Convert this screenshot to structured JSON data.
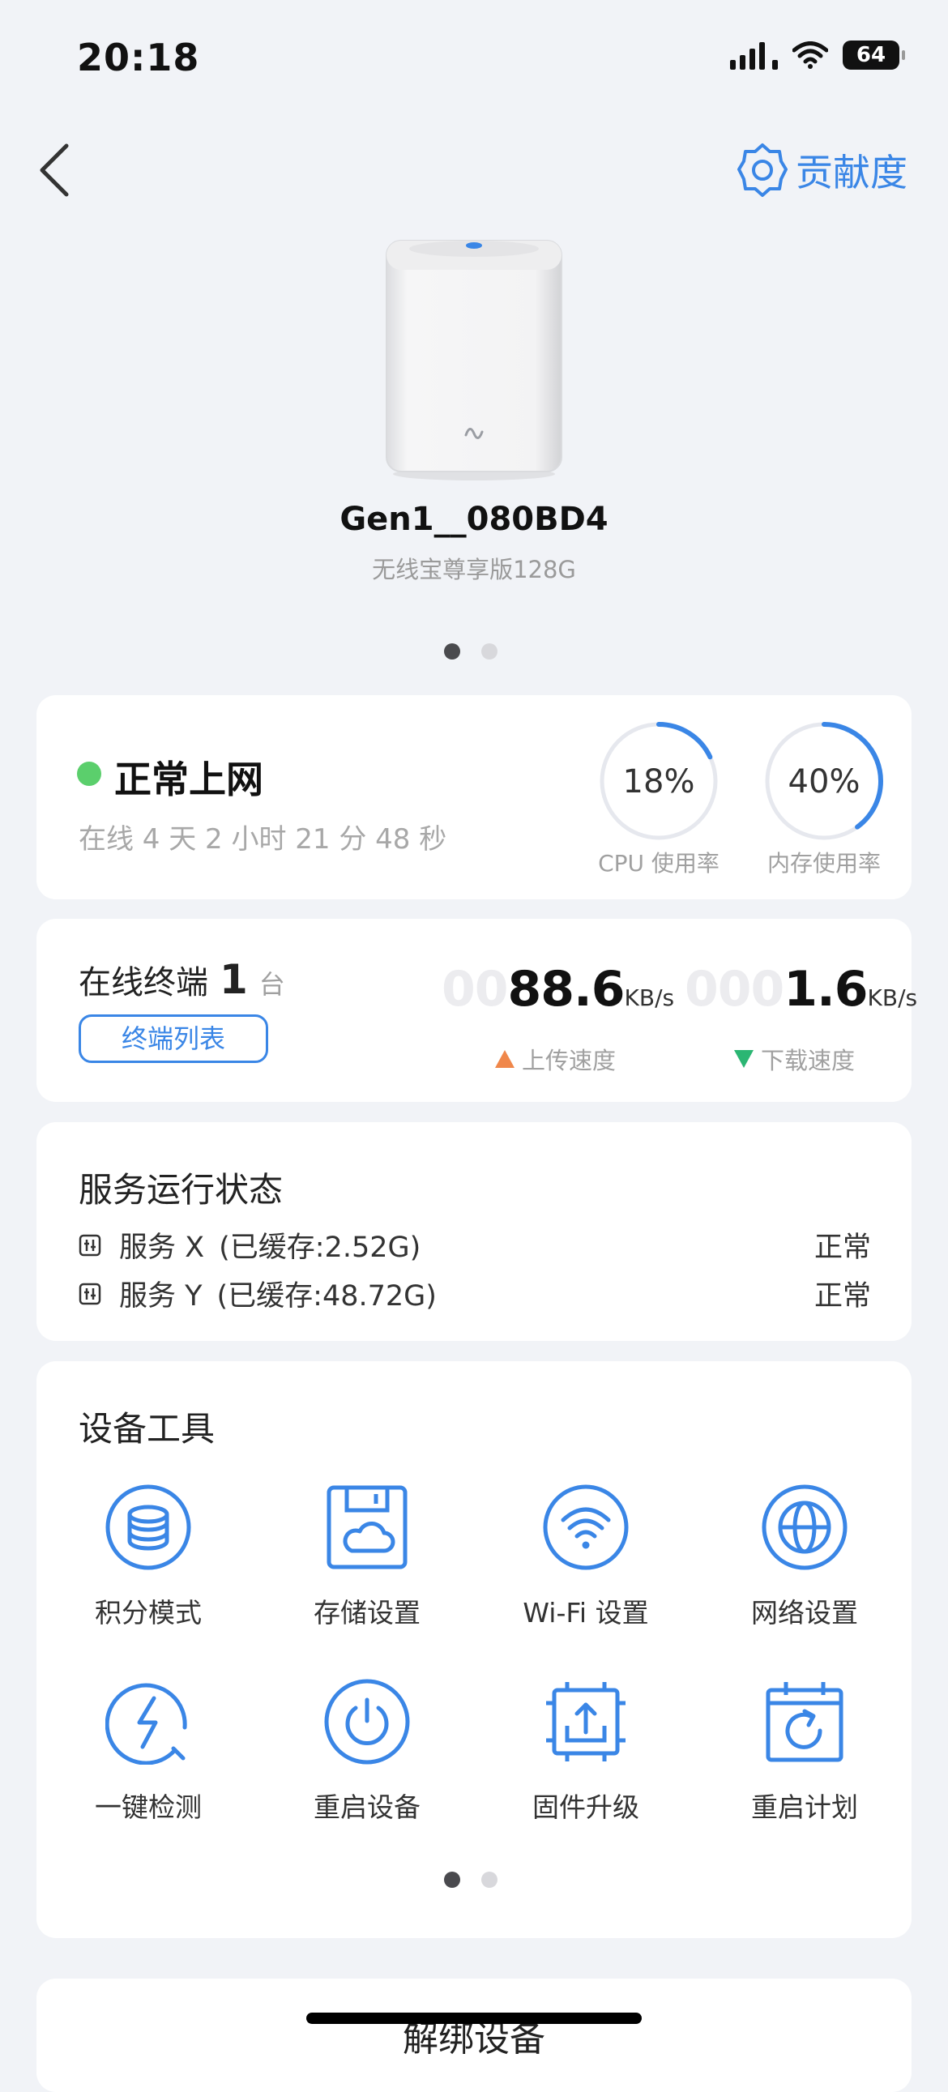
{
  "status_bar": {
    "time": "20:18",
    "battery": "64"
  },
  "header": {
    "contribution_label": "贡献度"
  },
  "device": {
    "name": "Gen1__080BD4",
    "model": "无线宝尊享版128G"
  },
  "network": {
    "status": "正常上网",
    "uptime": "在线 4 天 2 小时 21 分 48 秒",
    "status_color": "#5bcf6c",
    "cpu": {
      "value": 18,
      "text": "18%",
      "label": "CPU 使用率"
    },
    "memory": {
      "value": 40,
      "text": "40%",
      "label": "内存使用率"
    }
  },
  "terminals": {
    "label": "在线终端",
    "count": "1",
    "unit": "台",
    "list_button": "终端列表",
    "upload": {
      "ghost": "00",
      "value": "88.6",
      "unit": "KB/s",
      "label": "上传速度",
      "color": "#f0874a"
    },
    "download": {
      "ghost": "000",
      "value": "1.6",
      "unit": "KB/s",
      "label": "下载速度",
      "color": "#2bb673"
    }
  },
  "services": {
    "title": "服务运行状态",
    "items": [
      {
        "name": "服务 X",
        "cache": "(已缓存:2.52G)",
        "status": "正常"
      },
      {
        "name": "服务 Y",
        "cache": "(已缓存:48.72G)",
        "status": "正常"
      }
    ]
  },
  "tools": {
    "title": "设备工具",
    "items": [
      {
        "label": "积分模式",
        "icon": "coin-stack-icon"
      },
      {
        "label": "存储设置",
        "icon": "storage-cloud-icon"
      },
      {
        "label": "Wi-Fi 设置",
        "icon": "wifi-icon"
      },
      {
        "label": "网络设置",
        "icon": "globe-icon"
      },
      {
        "label": "一键检测",
        "icon": "lightning-check-icon"
      },
      {
        "label": "重启设备",
        "icon": "power-icon"
      },
      {
        "label": "固件升级",
        "icon": "chip-upload-icon"
      },
      {
        "label": "重启计划",
        "icon": "calendar-refresh-icon"
      }
    ]
  },
  "unbind_button": "解绑设备",
  "accent_color": "#3a86e6"
}
